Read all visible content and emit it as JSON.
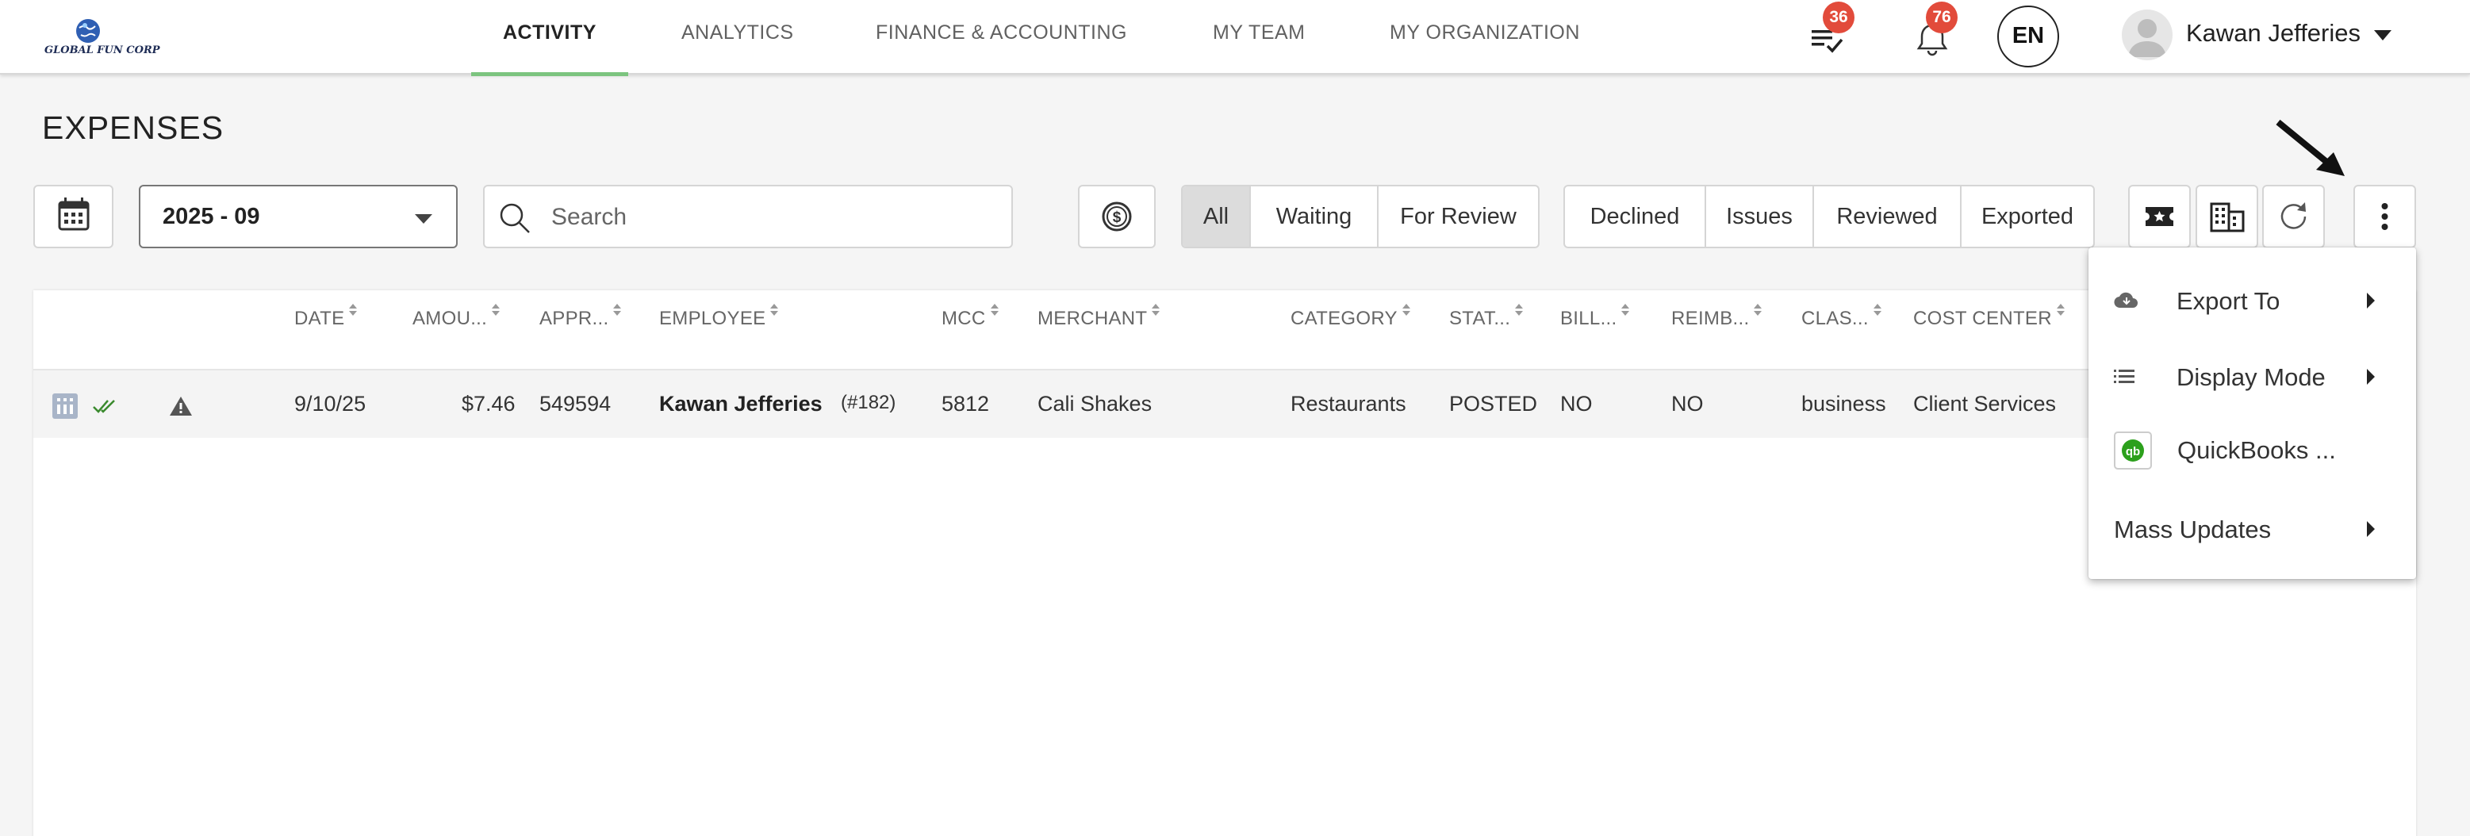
{
  "logo": {
    "text": "GLOBAL FUN CORP"
  },
  "nav": {
    "tabs": [
      {
        "label": "ACTIVITY"
      },
      {
        "label": "ANALYTICS"
      },
      {
        "label": "FINANCE & ACCOUNTING"
      },
      {
        "label": "MY TEAM"
      },
      {
        "label": "MY ORGANIZATION"
      }
    ],
    "tasks_badge": "36",
    "notifications_badge": "76",
    "language": "EN",
    "user_name": "Kawan Jefferies"
  },
  "page": {
    "title": "EXPENSES"
  },
  "toolbar": {
    "period": "2025 - 09",
    "search_placeholder": "Search",
    "filters_left": [
      "All",
      "Waiting",
      "For Review"
    ],
    "filters_right": [
      "Declined",
      "Issues",
      "Reviewed",
      "Exported"
    ]
  },
  "table": {
    "headers": [
      "DATE",
      "AMOU...",
      "APPR...",
      "EMPLOYEE",
      "MCC",
      "MERCHANT",
      "CATEGORY",
      "STAT...",
      "BILL...",
      "REIMB...",
      "CLAS...",
      "COST CENTER"
    ],
    "rows": [
      {
        "date": "9/10/25",
        "amount": "$7.46",
        "approval": "549594",
        "employee": "Kawan Jefferies",
        "employee_id": "(#182)",
        "mcc": "5812",
        "merchant": "Cali Shakes",
        "category": "Restaurants",
        "status": "POSTED",
        "billable": "NO",
        "reimbursable": "NO",
        "class": "business",
        "cost_center": "Client Services"
      }
    ]
  },
  "menu": {
    "items": [
      {
        "label": "Export To"
      },
      {
        "label": "Display Mode"
      },
      {
        "label": "QuickBooks ..."
      },
      {
        "label": "Mass Updates"
      }
    ]
  },
  "colors": {
    "active_tab_underline": "#7cc47f",
    "badge": "#e24b3b",
    "active_filter": "#dcdcdc",
    "reviewed_check": "#3a8a2e",
    "quickbooks": "#2ca01c"
  }
}
